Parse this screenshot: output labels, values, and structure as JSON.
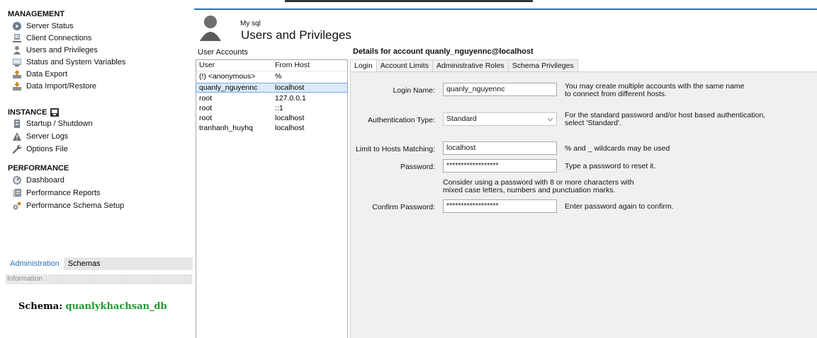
{
  "sidebar": {
    "management_title": "MANAGEMENT",
    "management_items": [
      {
        "label": "Server Status",
        "icon": "server-status-icon"
      },
      {
        "label": "Client Connections",
        "icon": "client-connections-icon"
      },
      {
        "label": "Users and Privileges",
        "icon": "users-icon"
      },
      {
        "label": "Status and System Variables",
        "icon": "variables-icon"
      },
      {
        "label": "Data Export",
        "icon": "export-icon"
      },
      {
        "label": "Data Import/Restore",
        "icon": "import-icon"
      }
    ],
    "instance_title": "INSTANCE",
    "instance_items": [
      {
        "label": "Startup / Shutdown",
        "icon": "startup-icon"
      },
      {
        "label": "Server Logs",
        "icon": "warning-icon"
      },
      {
        "label": "Options File",
        "icon": "wrench-icon"
      }
    ],
    "performance_title": "PERFORMANCE",
    "performance_items": [
      {
        "label": "Dashboard",
        "icon": "dashboard-icon"
      },
      {
        "label": "Performance Reports",
        "icon": "reports-icon"
      },
      {
        "label": "Performance Schema Setup",
        "icon": "schema-setup-icon"
      }
    ],
    "tabs": [
      "Administration",
      "Schemas"
    ],
    "info_header": "Information",
    "schema_label": "Schema:",
    "schema_value": "quanlykhachsan_db"
  },
  "header": {
    "connection_name": "My sql",
    "title": "Users and Privileges"
  },
  "accounts": {
    "label": "User Accounts",
    "columns": [
      "User",
      "From Host"
    ],
    "rows": [
      {
        "user": "(!) <anonymous>",
        "host": "%"
      },
      {
        "user": "quanly_nguyennc",
        "host": "localhost",
        "selected": true
      },
      {
        "user": "root",
        "host": "127.0.0.1"
      },
      {
        "user": "root",
        "host": "::1"
      },
      {
        "user": "root",
        "host": "localhost"
      },
      {
        "user": "tranhanh_huyhq",
        "host": "localhost"
      }
    ]
  },
  "details": {
    "title": "Details for account quanly_nguyennc@localhost",
    "tabs": [
      "Login",
      "Account Limits",
      "Administrative Roles",
      "Schema Privileges"
    ],
    "login_name_label": "Login Name:",
    "login_name_value": "quanly_nguyennc",
    "login_name_help_1": "You may create multiple accounts with the same name",
    "login_name_help_2": "to connect from different hosts.",
    "auth_type_label": "Authentication Type:",
    "auth_type_value": "Standard",
    "auth_type_help_1": "For the standard password and/or host based authentication,",
    "auth_type_help_2": "select 'Standard'.",
    "hosts_label": "Limit to Hosts Matching:",
    "hosts_value": "localhost",
    "hosts_help": "% and _ wildcards may be used",
    "password_label": "Password:",
    "password_value": "******************",
    "password_help": "Type a password to reset it.",
    "password_hint_1": "Consider using a password with 8 or more characters with",
    "password_hint_2": "mixed case letters, numbers and punctuation marks.",
    "confirm_label": "Confirm Password:",
    "confirm_value": "******************",
    "confirm_help": "Enter password again to confirm."
  },
  "colors": {
    "accent": "#2a6fbd",
    "schema_green": "#1f9a2f",
    "selected_row": "#dbe9f8",
    "panel_bg": "#f0f0f0"
  }
}
